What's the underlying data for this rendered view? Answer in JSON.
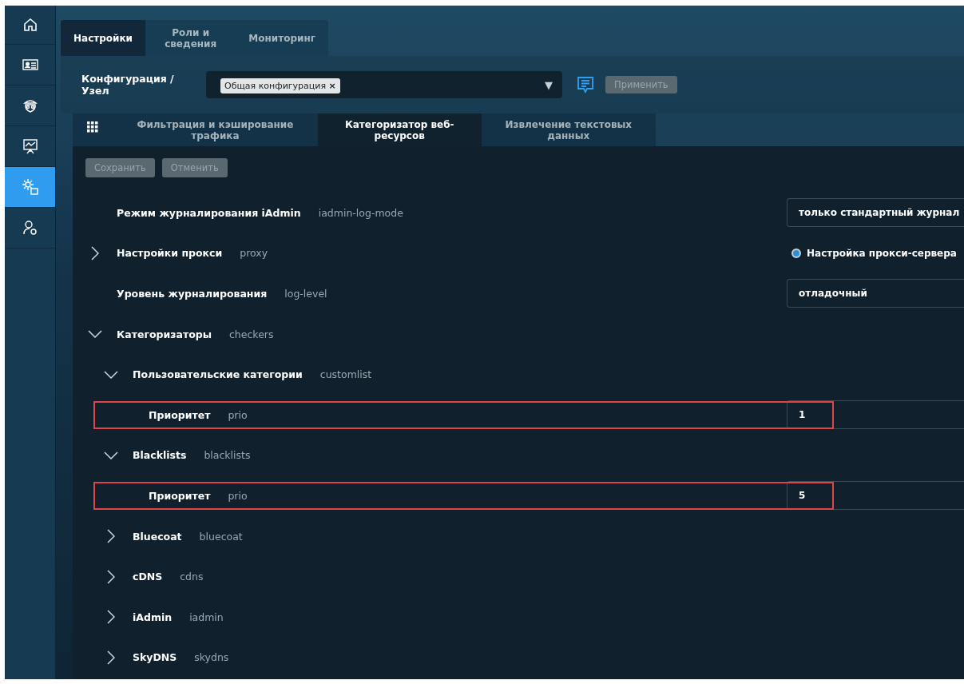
{
  "sidebar": {
    "items": [
      {
        "kind": "home",
        "selected": false
      },
      {
        "kind": "contact-card",
        "selected": false
      },
      {
        "kind": "agent",
        "selected": false
      },
      {
        "kind": "presentation",
        "selected": false
      },
      {
        "kind": "gears",
        "selected": true
      },
      {
        "kind": "user-gear",
        "selected": false
      }
    ]
  },
  "tabs": [
    {
      "label": "Настройки",
      "selected": true
    },
    {
      "label": "Роли и сведения",
      "selected": false
    },
    {
      "label": "Мониторинг",
      "selected": false
    }
  ],
  "config": {
    "label": "Конфигурация / Узел",
    "chips": [
      {
        "label": "Общая конфигурация",
        "remove": "×"
      }
    ],
    "dropdown_arrow": "▼",
    "apply": {
      "label": "Применить",
      "disabled": true
    }
  },
  "subtabs": [
    {
      "label": "Фильтрация и кэширование трафика",
      "selected": false
    },
    {
      "label": "Категоризатор веб-ресурсов",
      "selected": true
    },
    {
      "label": "Извлечение текстовых данных",
      "selected": false
    }
  ],
  "actions": [
    {
      "label": "Сохранить",
      "disabled": true
    },
    {
      "label": "Отменить",
      "disabled": true
    }
  ],
  "tree": [
    {
      "label": "Режим журналирования iAdmin",
      "key": "iadmin-log-mode",
      "control": {
        "kind": "select",
        "value": "только стандартный журнал"
      }
    },
    {
      "label": "Настройки прокси",
      "key": "proxy",
      "expanded": false,
      "control": {
        "kind": "radio",
        "label": "Настройка прокси-сервера",
        "selected": true
      }
    },
    {
      "label": "Уровень журналирования",
      "key": "log-level",
      "control": {
        "kind": "select",
        "value": "отладочный"
      }
    },
    {
      "label": "Категоризаторы",
      "key": "checkers",
      "expanded": true,
      "children": [
        {
          "label": "Пользовательские категории",
          "key": "customlist",
          "expanded": true,
          "children": [
            {
              "label": "Приоритет",
              "key": "prio",
              "highlighted": true,
              "control": {
                "kind": "input",
                "value": "1"
              }
            }
          ]
        },
        {
          "label": "Blacklists",
          "key": "blacklists",
          "expanded": true,
          "children": [
            {
              "label": "Приоритет",
              "key": "prio",
              "highlighted": true,
              "control": {
                "kind": "input",
                "value": "5"
              }
            }
          ]
        },
        {
          "label": "Bluecoat",
          "key": "bluecoat",
          "expanded": false
        },
        {
          "label": "cDNS",
          "key": "cdns",
          "expanded": false
        },
        {
          "label": "iAdmin",
          "key": "iadmin",
          "expanded": false
        },
        {
          "label": "SkyDNS",
          "key": "skydns",
          "expanded": false
        }
      ]
    }
  ]
}
